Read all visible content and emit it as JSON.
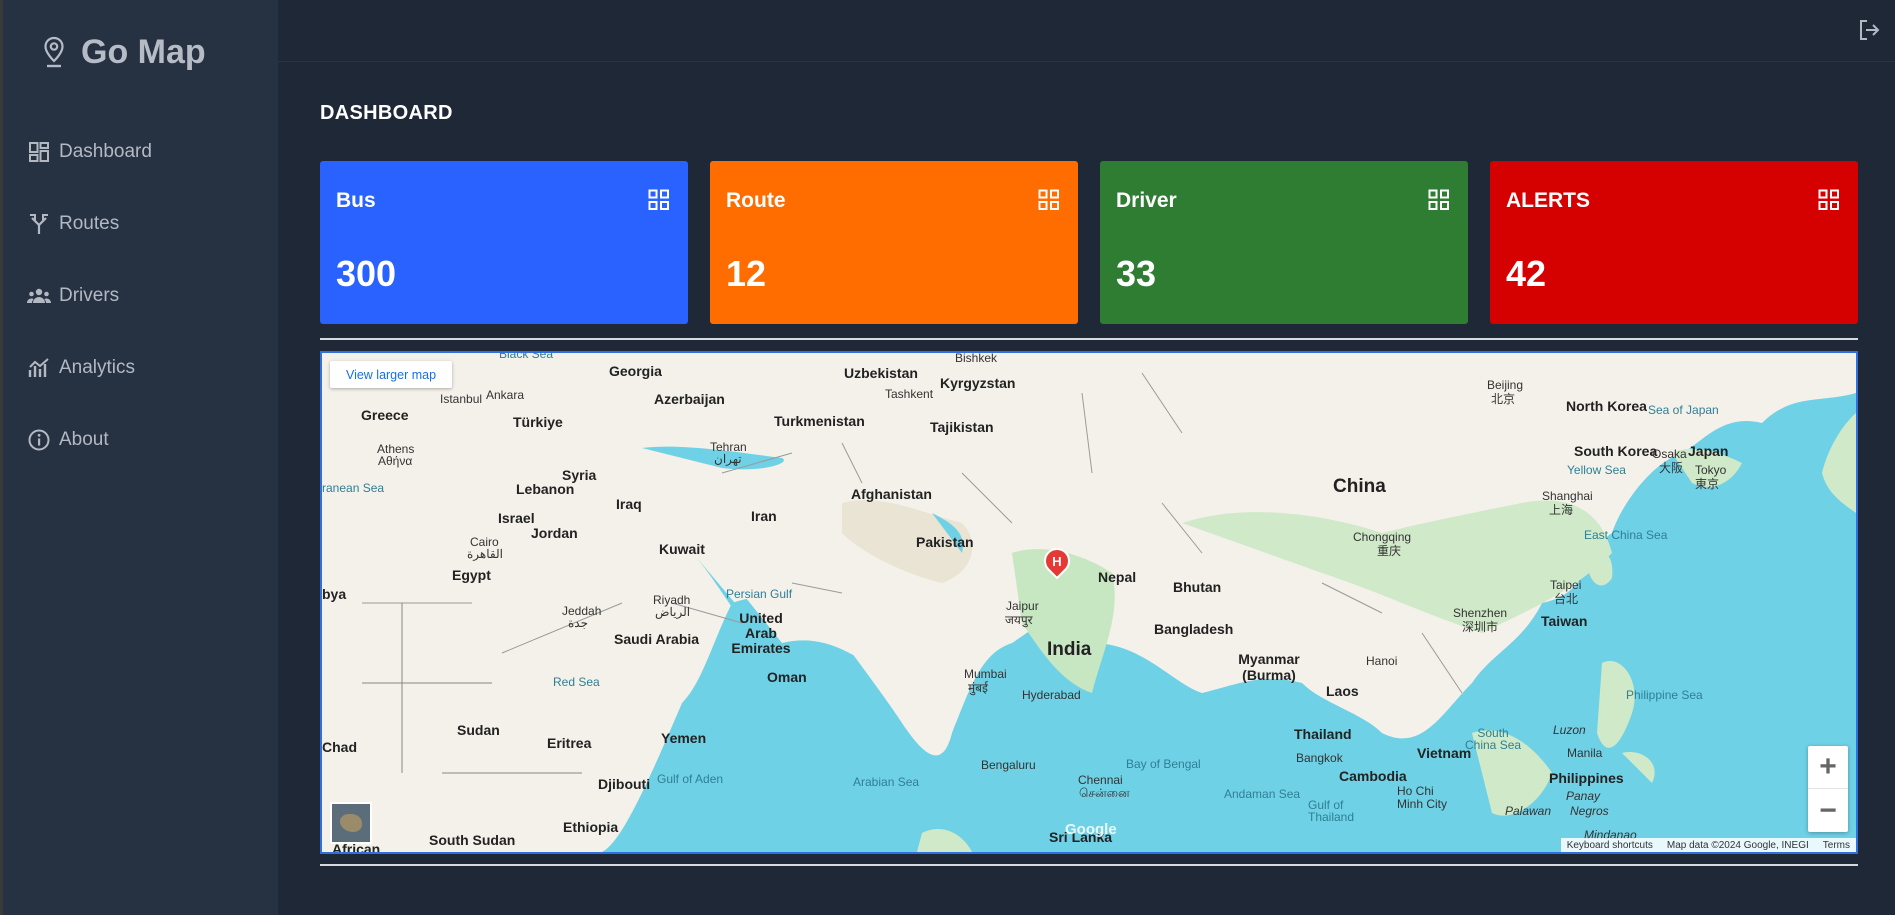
{
  "app": {
    "name": "Go Map"
  },
  "sidebar": {
    "items": [
      {
        "label": "Dashboard",
        "icon": "dashboard-icon"
      },
      {
        "label": "Routes",
        "icon": "routes-icon"
      },
      {
        "label": "Drivers",
        "icon": "drivers-icon"
      },
      {
        "label": "Analytics",
        "icon": "analytics-icon"
      },
      {
        "label": "About",
        "icon": "info-icon"
      }
    ]
  },
  "header": {
    "logout_icon": "logout-icon"
  },
  "page": {
    "title": "DASHBOARD"
  },
  "cards": [
    {
      "label": "Bus",
      "value": "300",
      "color": "#2a62ff"
    },
    {
      "label": "Route",
      "value": "12",
      "color": "#ff6d00"
    },
    {
      "label": "Driver",
      "value": "33",
      "color": "#2e7d32"
    },
    {
      "label": "ALERTS",
      "value": "42",
      "color": "#d50000"
    }
  ],
  "map": {
    "view_larger": "View larger map",
    "marker": "H",
    "zoom_in": "+",
    "zoom_out": "−",
    "google": "Google",
    "attribution": {
      "shortcuts": "Keyboard shortcuts",
      "data": "Map data ©2024 Google, INEGI",
      "terms": "Terms"
    },
    "labels": {
      "georgia": "Georgia",
      "azerbaijan": "Azerbaijan",
      "uzbekistan": "Uzbekistan",
      "kyrgyzstan": "Kyrgyzstan",
      "turkmenistan": "Turkmenistan",
      "tajikistan": "Tajikistan",
      "greece": "Greece",
      "turkiye": "Türkiye",
      "istanbul": "Istanbul",
      "ankara": "Ankara",
      "athens": "Athens",
      "athens_local": "Αθήνα",
      "syria": "Syria",
      "lebanon": "Lebanon",
      "iraq": "Iraq",
      "israel": "Israel",
      "jordan": "Jordan",
      "iran": "Iran",
      "tehran": "Tehran",
      "tehran_local": "تهران",
      "afghanistan": "Afghanistan",
      "pakistan": "Pakistan",
      "kuwait": "Kuwait",
      "egypt": "Egypt",
      "cairo": "Cairo",
      "cairo_local": "القاهرة",
      "riyadh": "Riyadh",
      "riyadh_local": "الرياض",
      "saudi": "Saudi Arabia",
      "uae": "United Arab Emirates",
      "oman": "Oman",
      "persian_gulf": "Persian Gulf",
      "jeddah": "Jeddah",
      "jeddah_local": "جدة",
      "red_sea": "Red Sea",
      "sudan": "Sudan",
      "chad": "Chad",
      "eritrea": "Eritrea",
      "yemen": "Yemen",
      "djibouti": "Djibouti",
      "gulf_aden": "Gulf of Aden",
      "ethiopia": "Ethiopia",
      "south_sudan": "South Sudan",
      "african": "African",
      "libya": "bya",
      "med_sea": "ranean Sea",
      "china": "China",
      "india": "India",
      "nepal": "Nepal",
      "bhutan": "Bhutan",
      "bangladesh": "Bangladesh",
      "myanmar": "Myanmar\n(Burma)",
      "laos": "Laos",
      "thailand": "Thailand",
      "vietnam": "Vietnam",
      "cambodia": "Cambodia",
      "hanoi": "Hanoi",
      "bangkok": "Bangkok",
      "hcm": "Ho Chi\nMinh City",
      "mumbai": "Mumbai",
      "mumbai_local": "मुंबई",
      "hyderabad": "Hyderabad",
      "jaipur": "Jaipur",
      "jaipur_local": "जयपुर",
      "bengaluru": "Bengaluru",
      "chennai": "Chennai",
      "chennai_local": "சென்னை",
      "sri_lanka": "Sri Lanka",
      "arabian_sea": "Arabian Sea",
      "bay_bengal": "Bay of Bengal",
      "andaman": "Andaman Sea",
      "gulf_thailand": "Gulf of\nThailand",
      "beijing": "Beijing",
      "beijing_local": "北京",
      "chongqing": "Chongqing",
      "chongqing_local": "重庆",
      "shanghai": "Shanghai",
      "shanghai_local": "上海",
      "shenzhen": "Shenzhen",
      "shenzhen_local": "深圳市",
      "taipei": "Taipei",
      "taipei_local": "台北",
      "taiwan": "Taiwan",
      "north_korea": "North Korea",
      "south_korea": "South Korea",
      "japan": "Japan",
      "osaka": "Osaka",
      "osaka_local": "大阪",
      "tokyo": "Tokyo",
      "tokyo_local": "東京",
      "sea_japan": "Sea of Japan",
      "yellow_sea": "Yellow Sea",
      "east_china_sea": "East China Sea",
      "south_china_sea": "South\nChina Sea",
      "philippine_sea": "Philippine Sea",
      "philippines": "Philippines",
      "manila": "Manila",
      "luzon": "Luzon",
      "palawan": "Palawan",
      "negros": "Negros",
      "panay": "Panay",
      "mindanao": "Mindanao",
      "tashkent": "Tashkent",
      "bishkek": "Bishkek",
      "black_sea": "Black Sea"
    }
  }
}
